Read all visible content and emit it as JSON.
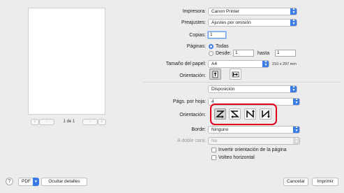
{
  "preview": {
    "page_count": "1 de 1",
    "nav_first": "«",
    "nav_prev": "‹",
    "nav_next": "›",
    "nav_last": "»"
  },
  "printer": {
    "label": "Impresora:",
    "value": "Canon Printer"
  },
  "presets": {
    "label": "Preajustes:",
    "value": "Ajustes por omisión"
  },
  "copies": {
    "label": "Copias:",
    "value": "1"
  },
  "pages": {
    "label": "Páginas:",
    "all_label": "Todas",
    "from_label": "Desde:",
    "from_value": "1",
    "to_label": "hasta",
    "to_value": "1"
  },
  "paper_size": {
    "label": "Tamaño del papel:",
    "value": "A4",
    "dimensions": "210 x 297 mm"
  },
  "orientation": {
    "label": "Orientación:"
  },
  "section": {
    "value": "Disposición"
  },
  "pages_per_sheet": {
    "label": "Págs. por hoja:",
    "value": "4"
  },
  "layout_direction": {
    "label": "Orientación:"
  },
  "border": {
    "label": "Borde:",
    "value": "Ninguno"
  },
  "two_sided": {
    "label": "A doble cara:",
    "value": "No"
  },
  "reverse_orientation": {
    "label": "Invertir orientación de la página"
  },
  "flip_horizontal": {
    "label": "Volteo horizontal"
  },
  "footer": {
    "help": "?",
    "pdf_label": "PDF",
    "hide_details": "Ocultar detalles",
    "cancel": "Cancelar",
    "print": "Imprimir"
  },
  "colors": {
    "accent": "#3b7be8",
    "highlight": "#e4001b"
  }
}
